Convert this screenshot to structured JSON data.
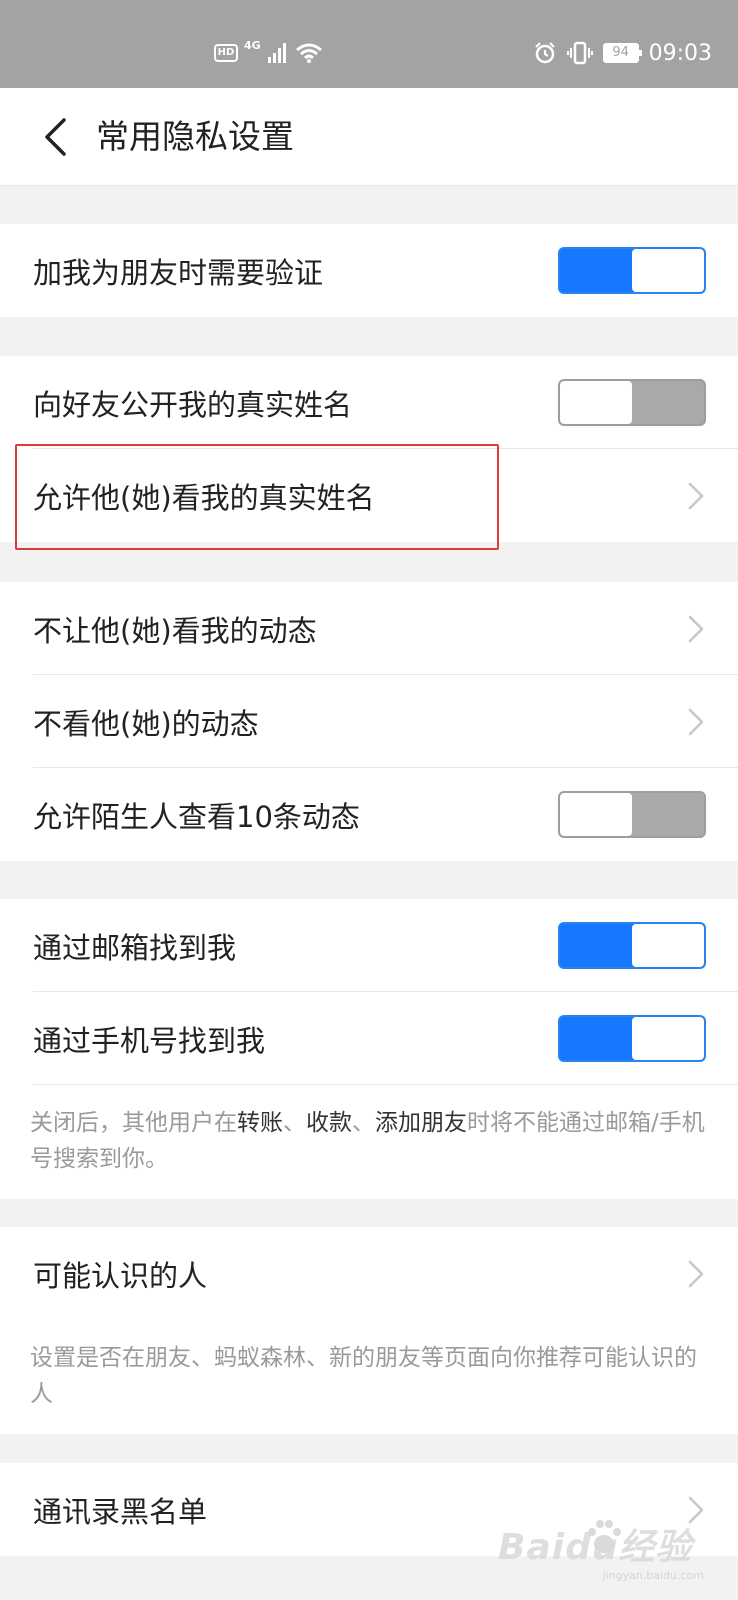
{
  "status_bar": {
    "hd": "HD",
    "network": "4G",
    "battery": "94",
    "time": "09:03"
  },
  "header": {
    "back_icon": "chevron-left-icon",
    "title": "常用隐私设置"
  },
  "settings": {
    "verify_friend": {
      "label": "加我为朋友时需要验证",
      "on": true
    },
    "show_real_name": {
      "label": "向好友公开我的真实姓名",
      "on": false
    },
    "allow_view_real_name": {
      "label": "允许他(她)看我的真实姓名"
    },
    "hide_my_moments": {
      "label": "不让他(她)看我的动态"
    },
    "hide_their_moments": {
      "label": "不看他(她)的动态"
    },
    "stranger_10_moments": {
      "label": "允许陌生人查看10条动态",
      "on": false
    },
    "find_by_email": {
      "label": "通过邮箱找到我",
      "on": true
    },
    "find_by_phone": {
      "label": "通过手机号找到我",
      "on": true
    },
    "find_note": {
      "prefix": "关闭后，其他用户在",
      "transfer": "转账",
      "sep1": "、",
      "receive": "收款",
      "sep2": "、",
      "add_friend": "添加朋友",
      "suffix": "时将不能通过邮箱/手机号搜索到你。"
    },
    "people_may_know": {
      "label": "可能认识的人"
    },
    "people_note": "设置是否在朋友、蚂蚁森林、新的朋友等页面向你推荐可能认识的人",
    "contact_blacklist": {
      "label": "通讯录黑名单"
    }
  },
  "watermark": {
    "text": "Baidu经验",
    "sub": "jingyan.baidu.com"
  },
  "colors": {
    "toggle_on": "#1677ff",
    "toggle_off": "#a9a9a9",
    "highlight_box": "#e03a3a"
  }
}
